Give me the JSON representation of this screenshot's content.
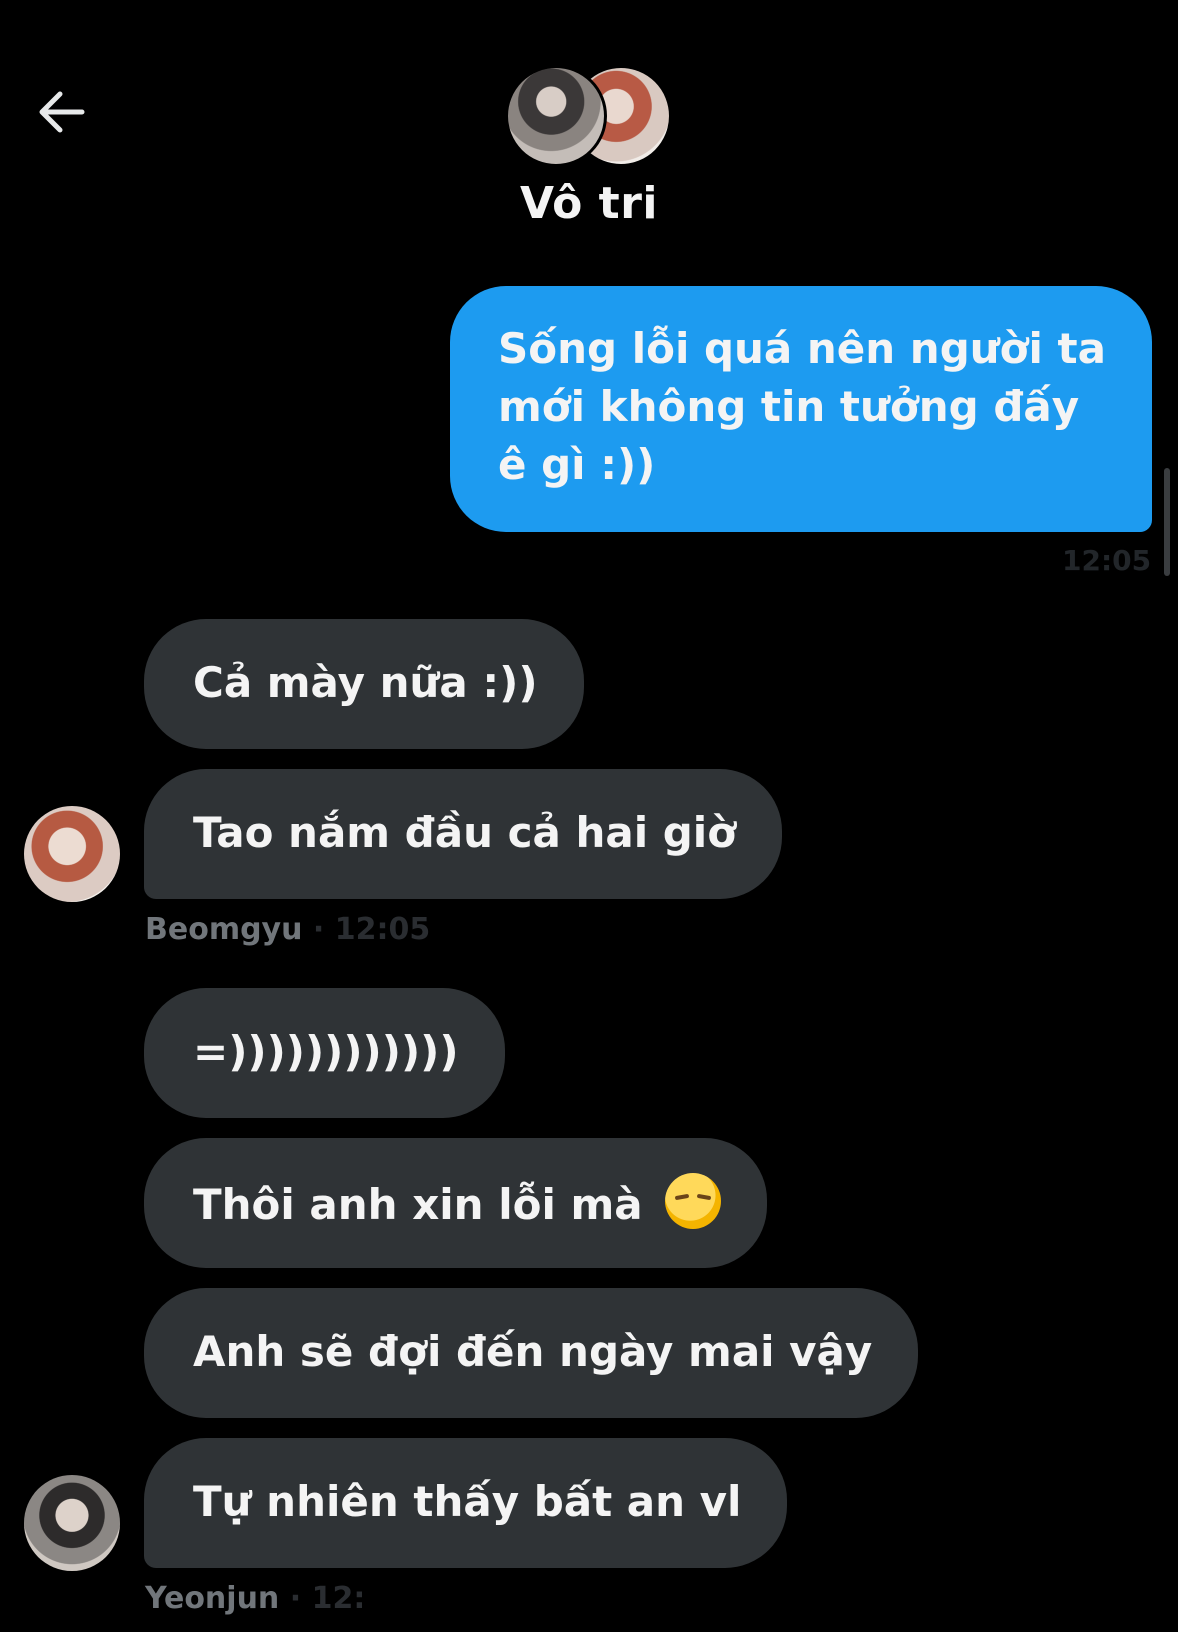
{
  "header": {
    "title": "Vô tri",
    "back_icon": "back-arrow-icon",
    "participants": [
      {
        "name": "Yeonjun",
        "icon": "avatar"
      },
      {
        "name": "Beomgyu",
        "icon": "avatar"
      }
    ]
  },
  "messages": [
    {
      "direction": "sent",
      "text": "Sống lỗi quá nên người ta mới không tin tưởng đấy ê gì :))",
      "time": "12:05"
    },
    {
      "direction": "received",
      "sender": "Beomgyu",
      "text": "Cả mày nữa :))"
    },
    {
      "direction": "received",
      "sender": "Beomgyu",
      "text": "Tao nắm đầu cả hai giờ"
    },
    {
      "direction": "received",
      "sender": "Yeonjun",
      "text": "=))))))))))))"
    },
    {
      "direction": "received",
      "sender": "Yeonjun",
      "text": "Thôi anh xin lỗi mà",
      "emoji": "pensive-face-emoji"
    },
    {
      "direction": "received",
      "sender": "Yeonjun",
      "text": "Anh sẽ đợi đến ngày mai vậy"
    },
    {
      "direction": "received",
      "sender": "Yeonjun",
      "text": "Tự nhiên thấy bất an vl"
    }
  ],
  "meta": {
    "beomgyu_label": "Beomgyu",
    "beomgyu_time": " · 12:05",
    "yeonjun_label": "Yeonjun",
    "yeonjun_time": " · 12:"
  },
  "colors": {
    "background": "#000000",
    "sent_bubble": "#1d9bf0",
    "received_bubble": "#2f3336",
    "muted_text": "#71767b"
  }
}
